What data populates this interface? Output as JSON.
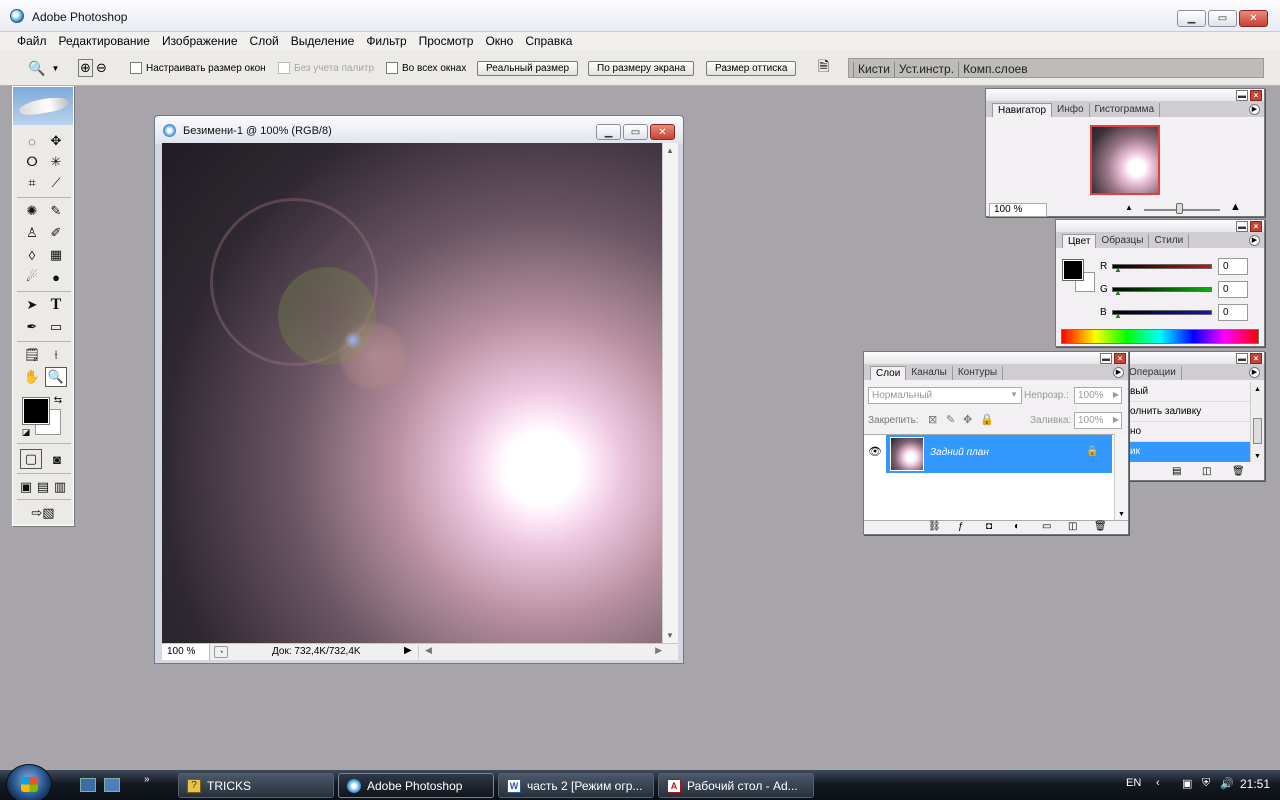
{
  "window": {
    "title": "Adobe Photoshop"
  },
  "menu": [
    "Файл",
    "Редактирование",
    "Изображение",
    "Слой",
    "Выделение",
    "Фильтр",
    "Просмотр",
    "Окно",
    "Справка"
  ],
  "options": {
    "resize_windows": "Настраивать размер окон",
    "ignore_palettes": "Без учета палитр",
    "all_windows": "Во всех окнах",
    "actual_pixels": "Реальный размер",
    "fit_screen": "По размеру экрана",
    "print_size": "Размер оттиска",
    "well_tabs": [
      "Кисти",
      "Уст.инстр.",
      "Комп.слоев"
    ]
  },
  "document": {
    "title": "Безимени-1 @ 100% (RGB/8)",
    "zoom": "100 %",
    "doc_info": "Док: 732,4K/732,4K"
  },
  "navigator": {
    "tabs": [
      "Навигатор",
      "Инфо",
      "Гистограмма"
    ],
    "zoom": "100 %",
    "zoom_level": 0.46
  },
  "color": {
    "tabs": [
      "Цвет",
      "Образцы",
      "Стили"
    ],
    "channels": [
      {
        "label": "R",
        "value": "0",
        "color": "#d01010"
      },
      {
        "label": "G",
        "value": "0",
        "color": "#10b010"
      },
      {
        "label": "B",
        "value": "0",
        "color": "#1010d0"
      }
    ]
  },
  "history": {
    "tab": "Операции",
    "items": [
      "вый",
      "олнить заливку",
      "но",
      "ик"
    ]
  },
  "layers": {
    "tabs": [
      "Слои",
      "Каналы",
      "Контуры"
    ],
    "blend_mode": "Нормальный",
    "opacity_label": "Непрозр.:",
    "opacity": "100%",
    "lock_label": "Закрепить:",
    "fill_label": "Заливка:",
    "fill": "100%",
    "layer_name": "Задний план"
  },
  "taskbar": {
    "tasks": [
      "TRICKS",
      "Adobe Photoshop",
      "часть 2 [Режим огр...",
      "Рабочий стол - Ad..."
    ],
    "lang": "EN",
    "time": "21:51"
  },
  "colors": {
    "selection": "#3399ff",
    "accent": "#e04040"
  }
}
